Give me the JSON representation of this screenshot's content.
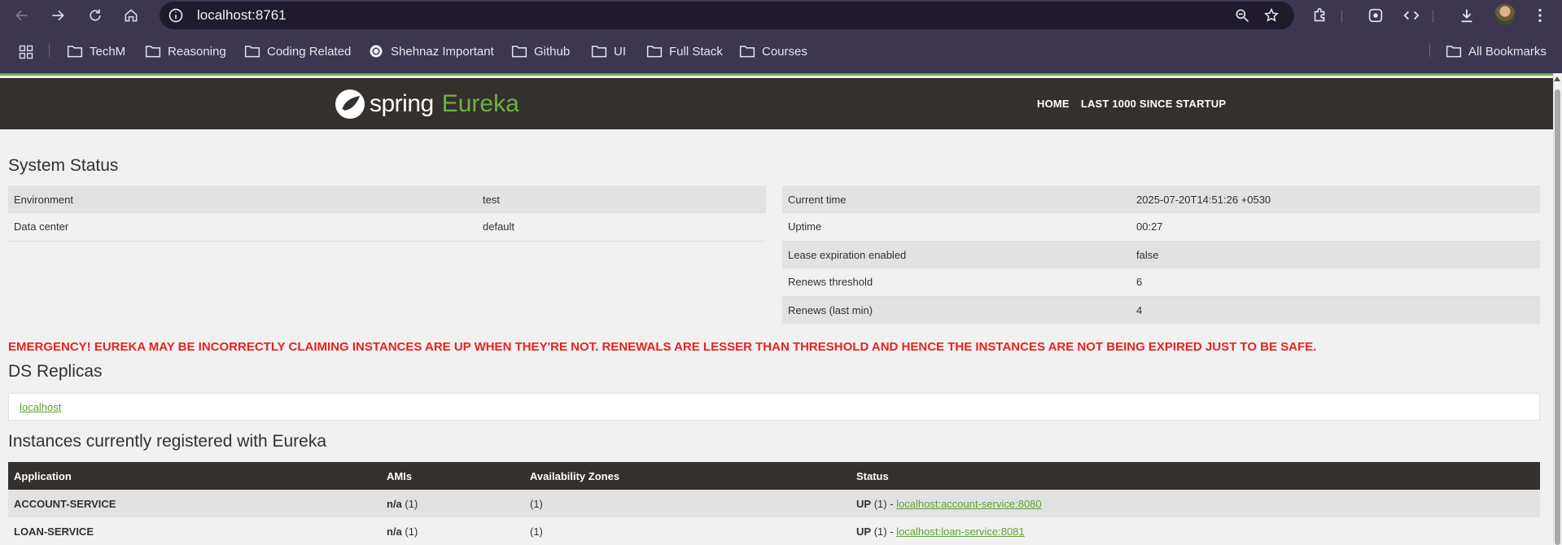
{
  "browser": {
    "url": "localhost:8761",
    "bookmarks": [
      "TechM",
      "Reasoning",
      "Coding Related",
      "Shehnaz Important",
      "Github",
      "UI",
      "Full Stack",
      "Courses"
    ],
    "all_bookmarks": "All Bookmarks"
  },
  "header": {
    "brand_spring": "spring",
    "brand_eureka": "Eureka",
    "nav_home": "HOME",
    "nav_last": "LAST 1000 SINCE STARTUP"
  },
  "system_status": {
    "title": "System Status",
    "left": [
      {
        "label": "Environment",
        "value": "test"
      },
      {
        "label": "Data center",
        "value": "default"
      }
    ],
    "right": [
      {
        "label": "Current time",
        "value": "2025-07-20T14:51:26 +0530"
      },
      {
        "label": "Uptime",
        "value": "00:27"
      },
      {
        "label": "Lease expiration enabled",
        "value": "false"
      },
      {
        "label": "Renews threshold",
        "value": "6"
      },
      {
        "label": "Renews (last min)",
        "value": "4"
      }
    ]
  },
  "emergency": "EMERGENCY! EUREKA MAY BE INCORRECTLY CLAIMING INSTANCES ARE UP WHEN THEY'RE NOT. RENEWALS ARE LESSER THAN THRESHOLD AND HENCE THE INSTANCES ARE NOT BEING EXPIRED JUST TO BE SAFE.",
  "replicas": {
    "title": "DS Replicas",
    "items": [
      "localhost"
    ]
  },
  "instances": {
    "title": "Instances currently registered with Eureka",
    "columns": [
      "Application",
      "AMIs",
      "Availability Zones",
      "Status"
    ],
    "rows": [
      {
        "application": "ACCOUNT-SERVICE",
        "ami": "n/a",
        "ami_count": "(1)",
        "zones": "(1)",
        "status": "UP",
        "status_count": "(1) -",
        "link": "localhost:account-service:8080"
      },
      {
        "application": "LOAN-SERVICE",
        "ami": "n/a",
        "ami_count": "(1)",
        "zones": "(1)",
        "status": "UP",
        "status_count": "(1) -",
        "link": "localhost:loan-service:8081"
      }
    ]
  }
}
